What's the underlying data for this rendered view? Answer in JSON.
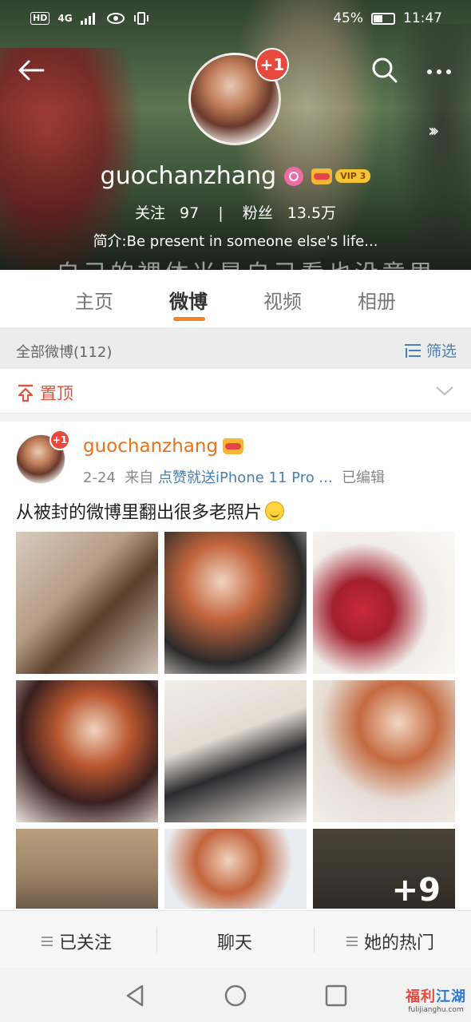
{
  "status_bar": {
    "hd": "HD",
    "network": "4G",
    "battery_percent": "45%",
    "battery_level": 0.45,
    "time": "11:47"
  },
  "profile": {
    "cover_text": "自己的裸体当是自己看也没意思",
    "avatar_badge": "+1",
    "username": "guochanzhang",
    "vip_label": "VIP 3",
    "following_label": "关注",
    "following_count": "97",
    "separator": "|",
    "followers_label": "粉丝",
    "followers_count": "13.5万",
    "bio": "简介:Be present in someone else's life..."
  },
  "tabs": [
    {
      "label": "主页",
      "active": false
    },
    {
      "label": "微博",
      "active": true
    },
    {
      "label": "视频",
      "active": false
    },
    {
      "label": "相册",
      "active": false
    }
  ],
  "filter_bar": {
    "count_label": "全部微博(112)",
    "filter_label": "筛选"
  },
  "pinned": {
    "label": "置顶"
  },
  "post": {
    "avatar_badge": "+1",
    "author": "guochanzhang",
    "date": "2-24",
    "from_label": "来自",
    "source": "点赞就送iPhone 11 Pro ...",
    "edited": "已编辑",
    "text": "从被封的微博里翻出很多老照片",
    "more_photos": "+9"
  },
  "actions": {
    "followed": "已关注",
    "chat": "聊天",
    "hot": "她的热门"
  },
  "watermark": {
    "line1_a": "福利",
    "line1_b": "江湖",
    "line2": "fulijianghu.com"
  },
  "colors": {
    "accent_orange": "#f58220",
    "link_blue": "#4a7fb5",
    "pin_red": "#e0533f",
    "badge_red": "#e8493f"
  }
}
